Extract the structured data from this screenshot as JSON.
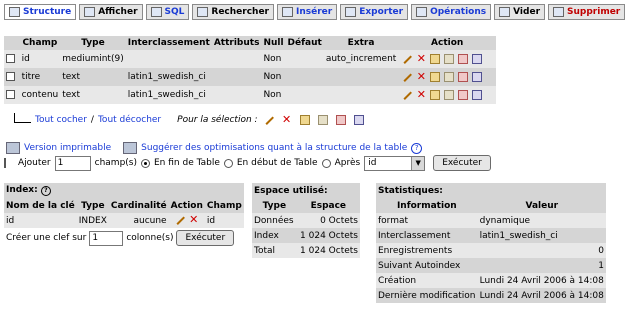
{
  "tabs": [
    {
      "label": "Structure",
      "icon": "structure-icon",
      "name": "tab-structure",
      "active": true,
      "cls": "active"
    },
    {
      "label": "Afficher",
      "icon": "table-icon",
      "name": "tab-afficher",
      "active": false,
      "cls": ""
    },
    {
      "label": "SQL",
      "icon": "sql-icon",
      "name": "tab-sql",
      "active": false,
      "cls": "blue"
    },
    {
      "label": "Rechercher",
      "icon": "search-icon",
      "name": "tab-rechercher",
      "active": false,
      "cls": ""
    },
    {
      "label": "Insérer",
      "icon": "insert-icon",
      "name": "tab-inserer",
      "active": false,
      "cls": "blue"
    },
    {
      "label": "Exporter",
      "icon": "export-icon",
      "name": "tab-exporter",
      "active": false,
      "cls": "blue"
    },
    {
      "label": "Opérations",
      "icon": "tools-icon",
      "name": "tab-operations",
      "active": false,
      "cls": "blue"
    },
    {
      "label": "Vider",
      "icon": "empty-icon",
      "name": "tab-vider",
      "active": false,
      "cls": ""
    },
    {
      "label": "Supprimer",
      "icon": "drop-icon",
      "name": "tab-supprimer",
      "active": false,
      "cls": "drop"
    }
  ],
  "fields_table": {
    "headers": [
      "Champ",
      "Type",
      "Interclassement",
      "Attributs",
      "Null",
      "Défaut",
      "Extra",
      "Action"
    ],
    "rows": [
      [
        "id",
        "mediumint(9)",
        "",
        "",
        "Non",
        "",
        "auto_increment"
      ],
      [
        "titre",
        "text",
        "latin1_swedish_ci",
        "",
        "Non",
        "",
        ""
      ],
      [
        "contenu",
        "text",
        "latin1_swedish_ci",
        "",
        "Non",
        "",
        ""
      ]
    ]
  },
  "selection": {
    "check_all": "Tout cocher",
    "separator": "/",
    "uncheck_all": "Tout décocher",
    "for_selection": "Pour la sélection :"
  },
  "links": {
    "print": "Version imprimable",
    "suggest": "Suggérer des optimisations quant à la structure de la table"
  },
  "add_row": {
    "label": "Ajouter",
    "count_value": "1",
    "fields_label": "champ(s)",
    "opt_end": "En fin de Table",
    "opt_start": "En début de Table",
    "opt_after": "Après",
    "after_value": "id",
    "execute": "Exécuter"
  },
  "index": {
    "title": "Index:",
    "headers": [
      "Nom de la clé",
      "Type",
      "Cardinalité",
      "Action",
      "Champ"
    ],
    "rows": [
      [
        "id",
        "INDEX",
        "aucune",
        "",
        "id"
      ]
    ],
    "create_label": "Créer une clef sur",
    "create_value": "1",
    "columns_label": "colonne(s)",
    "execute": "Exécuter"
  },
  "space": {
    "title": "Espace utilisé:",
    "headers": [
      "Type",
      "Espace"
    ],
    "rows": [
      [
        "Données",
        "0 Octets"
      ],
      [
        "Index",
        "1 024 Octets"
      ],
      [
        "Total",
        "1 024 Octets"
      ]
    ]
  },
  "stats": {
    "title": "Statistiques:",
    "headers": [
      "Information",
      "Valeur"
    ],
    "rows": [
      [
        "format",
        "dynamique"
      ],
      [
        "Interclassement",
        "latin1_swedish_ci"
      ],
      [
        "Enregistrements",
        "0"
      ],
      [
        "Suivant Autoindex",
        "1"
      ],
      [
        "Création",
        "Lundi 24 Avril 2006 à 14:08"
      ],
      [
        "Dernière modification",
        "Lundi 24 Avril 2006 à 14:08"
      ]
    ]
  }
}
